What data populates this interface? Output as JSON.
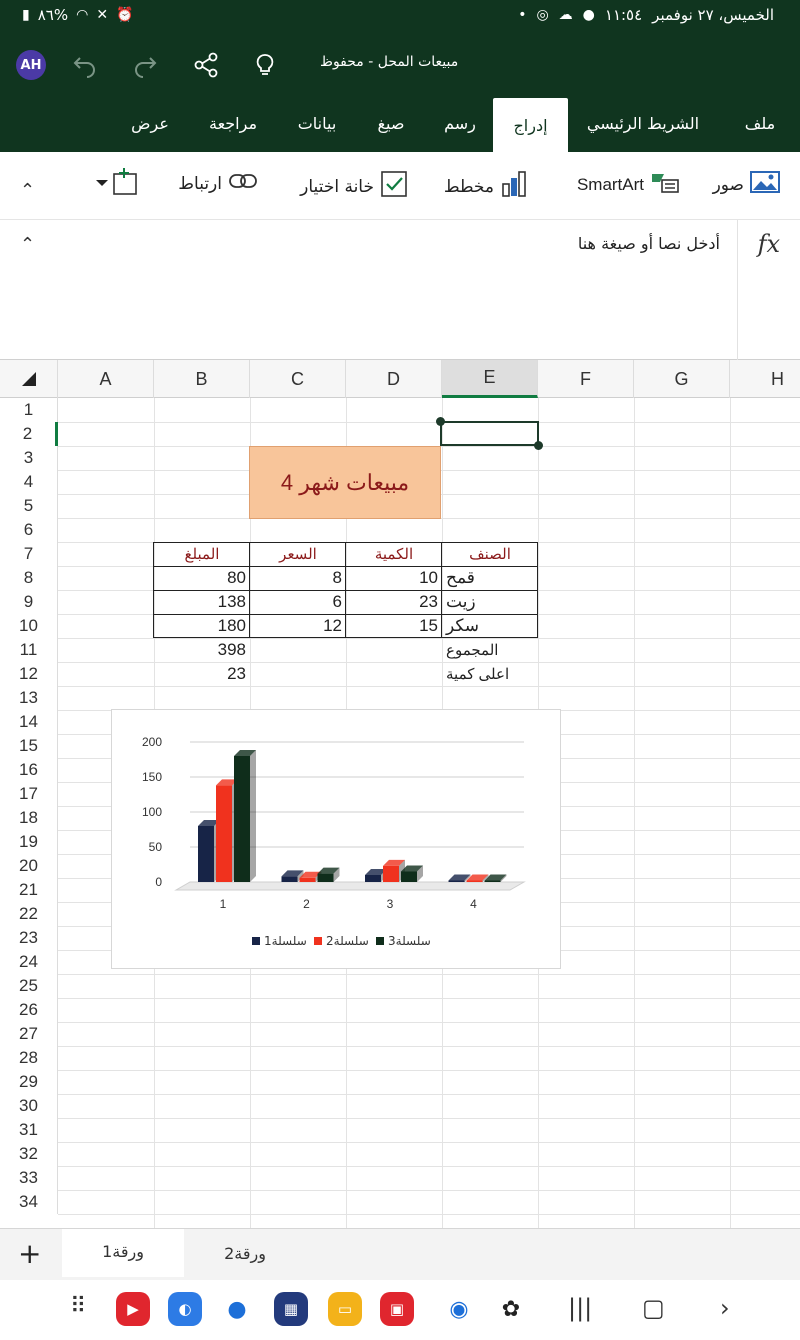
{
  "statusbar": {
    "battery": "٨٦%",
    "datetime": "الخميس، ٢٧ نوفمبر",
    "time": "١١:٥٤"
  },
  "titlebar": {
    "avatar": "AH",
    "doc_title": "مبيعات المحل - محفوظ"
  },
  "tabs": [
    {
      "label": "ملف"
    },
    {
      "label": "الشريط الرئيسي"
    },
    {
      "label": "إدراج"
    },
    {
      "label": "رسم"
    },
    {
      "label": "صيغ"
    },
    {
      "label": "بيانات"
    },
    {
      "label": "مراجعة"
    },
    {
      "label": "عرض"
    }
  ],
  "ribbon": {
    "pictures": "صور",
    "smartart": "SmartArt",
    "chart": "مخطط",
    "checkbox": "خانة اختيار",
    "link": "ارتباط"
  },
  "formula": {
    "fx": "fx",
    "placeholder": "أدخل نصا أو صيغة هنا"
  },
  "columns": [
    "A",
    "B",
    "C",
    "D",
    "E",
    "F",
    "G",
    "H"
  ],
  "rows": [
    "1",
    "2",
    "3",
    "4",
    "5",
    "6",
    "7",
    "8",
    "9",
    "10",
    "11",
    "12",
    "13",
    "14",
    "15",
    "16",
    "17",
    "18",
    "19",
    "20",
    "21",
    "22",
    "23",
    "24",
    "25",
    "26",
    "27",
    "28",
    "29",
    "30",
    "31",
    "32",
    "33",
    "34"
  ],
  "sheet": {
    "title": "مبيعات شهر 4",
    "headers": {
      "item": "الصنف",
      "qty": "الكمية",
      "price": "السعر",
      "amount": "المبلغ"
    },
    "rows": [
      {
        "item": "قمح",
        "qty": "10",
        "price": "8",
        "amount": "80"
      },
      {
        "item": "زيت",
        "qty": "23",
        "price": "6",
        "amount": "138"
      },
      {
        "item": "سكر",
        "qty": "15",
        "price": "12",
        "amount": "180"
      }
    ],
    "total_label": "المجموع",
    "total_value": "398",
    "max_label": "اعلى كمية",
    "max_value": "23"
  },
  "chart_data": {
    "type": "bar",
    "categories": [
      "1",
      "2",
      "3",
      "4"
    ],
    "series": [
      {
        "name": "سلسلة1",
        "values": [
          80,
          8,
          10,
          0
        ],
        "color": "#172447"
      },
      {
        "name": "سلسلة2",
        "values": [
          138,
          6,
          23,
          0
        ],
        "color": "#f0321e"
      },
      {
        "name": "سلسلة3",
        "values": [
          180,
          12,
          15,
          0
        ],
        "color": "#0f2d1b"
      }
    ],
    "yticks": [
      "0",
      "50",
      "100",
      "150",
      "200"
    ],
    "ylim": [
      0,
      200
    ],
    "legend": "bottom"
  },
  "sheet_tabs": [
    {
      "label": "ورقة1"
    },
    {
      "label": "ورقة2"
    }
  ],
  "colors": {
    "excel_green": "#10351f",
    "accent": "#107c41",
    "title_fill": "#f8c59a",
    "title_text": "#8b1a1a"
  }
}
